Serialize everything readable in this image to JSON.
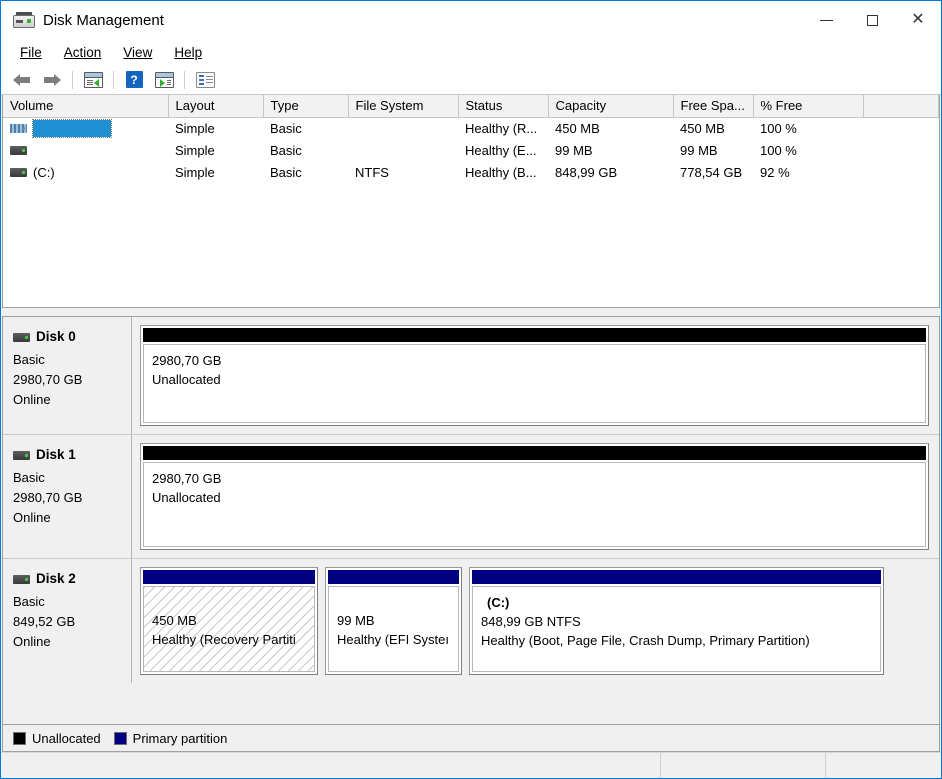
{
  "window": {
    "title": "Disk Management",
    "title_icon": "disk-drive-icon",
    "minimize_label": "—",
    "maximize_label": "",
    "close_label": "✕"
  },
  "menu": [
    {
      "label": "File",
      "accel": "F"
    },
    {
      "label": "Action",
      "accel": "A"
    },
    {
      "label": "View",
      "accel": "V"
    },
    {
      "label": "Help",
      "accel": "H"
    }
  ],
  "toolbar": [
    {
      "name": "back-arrow-icon",
      "tip": "Back"
    },
    {
      "name": "forward-arrow-icon",
      "tip": "Forward"
    },
    {
      "name": "show-hide-console-tree-icon",
      "tip": "Show/Hide Console Tree"
    },
    {
      "name": "help-icon",
      "tip": "Help",
      "glyph": "?"
    },
    {
      "name": "show-hide-action-pane-icon",
      "tip": "Show/Hide Action Pane"
    },
    {
      "name": "properties-icon",
      "tip": "Properties"
    }
  ],
  "volume_list": {
    "columns": [
      "Volume",
      "Layout",
      "Type",
      "File System",
      "Status",
      "Capacity",
      "Free Spa...",
      "% Free",
      ""
    ],
    "rows": [
      {
        "icon": "recovery-volume-icon",
        "volume": "",
        "selected": true,
        "layout": "Simple",
        "type": "Basic",
        "file_system": "",
        "status": "Healthy (R...",
        "capacity": "450 MB",
        "free_space": "450 MB",
        "percent_free": "100 %"
      },
      {
        "icon": "volume-icon",
        "volume": "",
        "selected": false,
        "layout": "Simple",
        "type": "Basic",
        "file_system": "",
        "status": "Healthy (E...",
        "capacity": "99 MB",
        "free_space": "99 MB",
        "percent_free": "100 %"
      },
      {
        "icon": "volume-icon",
        "volume": "(C:)",
        "selected": false,
        "layout": "Simple",
        "type": "Basic",
        "file_system": "NTFS",
        "status": "Healthy (B...",
        "capacity": "848,99 GB",
        "free_space": "778,54 GB",
        "percent_free": "92 %"
      }
    ]
  },
  "disks": [
    {
      "name": "Disk 0",
      "icon": "disk-icon",
      "type": "Basic",
      "size": "2980,70 GB",
      "status": "Online",
      "partitions": [
        {
          "cap_color": "black",
          "cap_class": "black",
          "hatched": false,
          "label": "",
          "size": "2980,70 GB",
          "detail": "Unallocated",
          "detail2": "",
          "flex": 1
        }
      ]
    },
    {
      "name": "Disk 1",
      "icon": "disk-icon",
      "type": "Basic",
      "size": "2980,70 GB",
      "status": "Online",
      "partitions": [
        {
          "cap_color": "black",
          "cap_class": "black",
          "hatched": false,
          "label": "",
          "size": "2980,70 GB",
          "detail": "Unallocated",
          "detail2": "",
          "flex": 1
        }
      ]
    },
    {
      "name": "Disk 2",
      "icon": "disk-icon",
      "type": "Basic",
      "size": "849,52 GB",
      "status": "Online",
      "partitions": [
        {
          "cap_color": "#000080",
          "cap_class": "blue",
          "hatched": true,
          "label": "",
          "size": "450 MB",
          "detail": "Healthy (Recovery Partiti",
          "detail2": "",
          "flex": 0
        },
        {
          "cap_color": "#000080",
          "cap_class": "blue",
          "hatched": false,
          "label": "",
          "size": "99 MB",
          "detail": "Healthy (EFI Systeı",
          "detail2": "",
          "flex": 0
        },
        {
          "cap_color": "#000080",
          "cap_class": "blue",
          "hatched": false,
          "label": "(C:)",
          "size": "848,99 GB NTFS",
          "detail": "Healthy (Boot, Page File, Crash Dump, Primary Partition)",
          "detail2": "",
          "flex": 0
        }
      ]
    }
  ],
  "legend": [
    {
      "label": "Unallocated",
      "color": "#000000"
    },
    {
      "label": "Primary partition",
      "color": "#000080"
    }
  ],
  "status_bar": {
    "pane1": "",
    "pane2": "",
    "pane3": ""
  },
  "colors": {
    "selection": "#1e90d2",
    "unallocated": "#000000",
    "primary_partition": "#000080",
    "window_border": "#0078d7"
  }
}
